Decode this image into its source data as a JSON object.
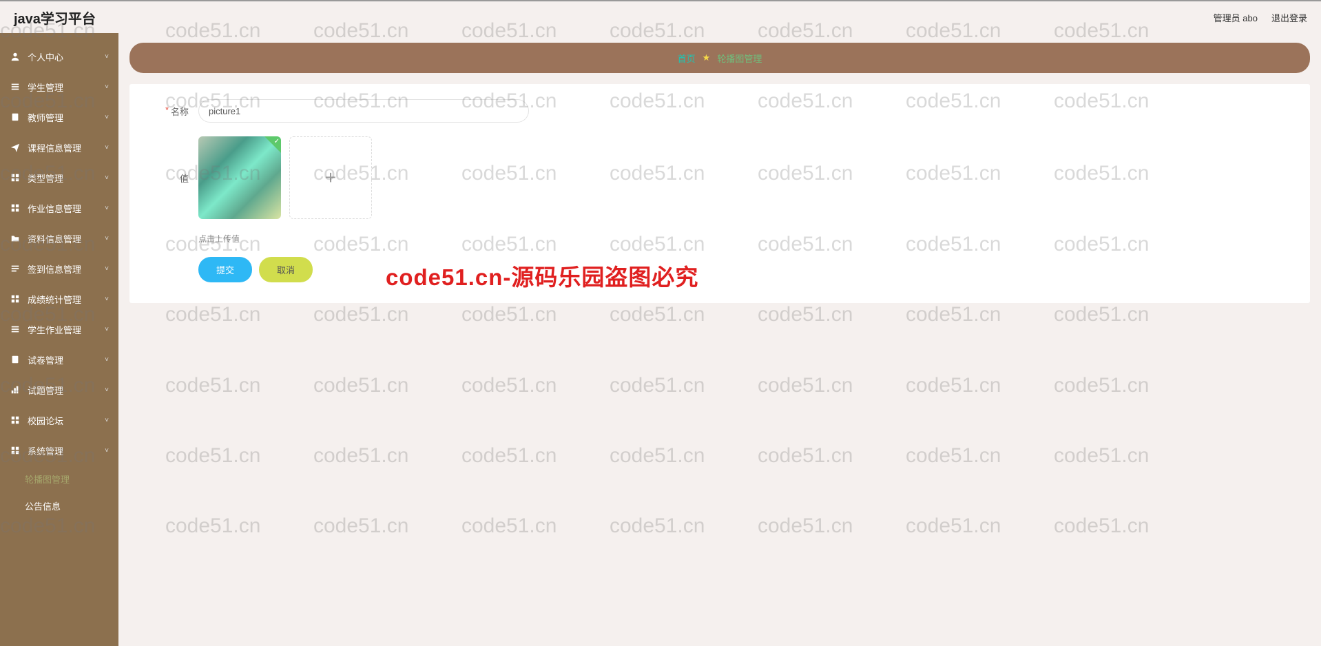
{
  "header": {
    "title": "java学习平台",
    "admin": "管理员 abo",
    "logout": "退出登录"
  },
  "sidebar": {
    "items": [
      {
        "label": "个人中心"
      },
      {
        "label": "学生管理"
      },
      {
        "label": "教师管理"
      },
      {
        "label": "课程信息管理"
      },
      {
        "label": "类型管理"
      },
      {
        "label": "作业信息管理"
      },
      {
        "label": "资料信息管理"
      },
      {
        "label": "签到信息管理"
      },
      {
        "label": "成绩统计管理"
      },
      {
        "label": "学生作业管理"
      },
      {
        "label": "试卷管理"
      },
      {
        "label": "试题管理"
      },
      {
        "label": "校园论坛"
      },
      {
        "label": "系统管理"
      }
    ],
    "subitems": [
      {
        "label": "轮播图管理"
      },
      {
        "label": "公告信息"
      }
    ]
  },
  "breadcrumb": {
    "home": "首页",
    "current": "轮播图管理"
  },
  "form": {
    "name_label": "名称",
    "name_value": "picture1",
    "value_label": "值",
    "upload_hint": "点击上传值",
    "submit": "提交",
    "cancel": "取消"
  },
  "watermark": {
    "text": "code51.cn",
    "big": "code51.cn-源码乐园盗图必究"
  }
}
